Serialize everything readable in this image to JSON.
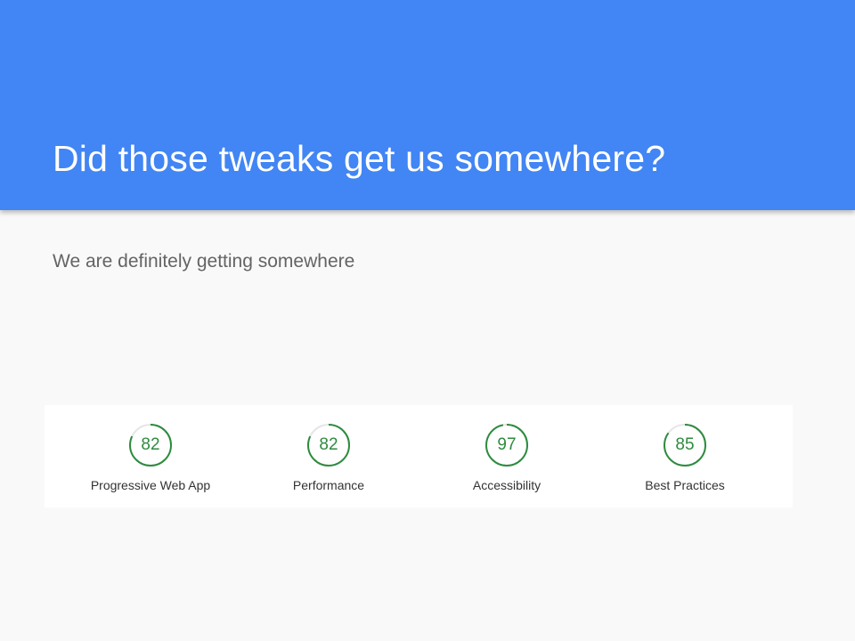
{
  "slide": {
    "title": "Did those tweaks get us somewhere?",
    "subtitle": "We are definitely getting somewhere"
  },
  "scores": [
    {
      "value": "82",
      "percent": 82,
      "label": "Progressive Web App"
    },
    {
      "value": "82",
      "percent": 82,
      "label": "Performance"
    },
    {
      "value": "97",
      "percent": 97,
      "label": "Accessibility"
    },
    {
      "value": "85",
      "percent": 85,
      "label": "Best Practices"
    }
  ],
  "colors": {
    "header": "#4285f4",
    "score_good": "#2e8b3e",
    "score_track": "#e6e6e6",
    "subtitle": "#646464"
  }
}
